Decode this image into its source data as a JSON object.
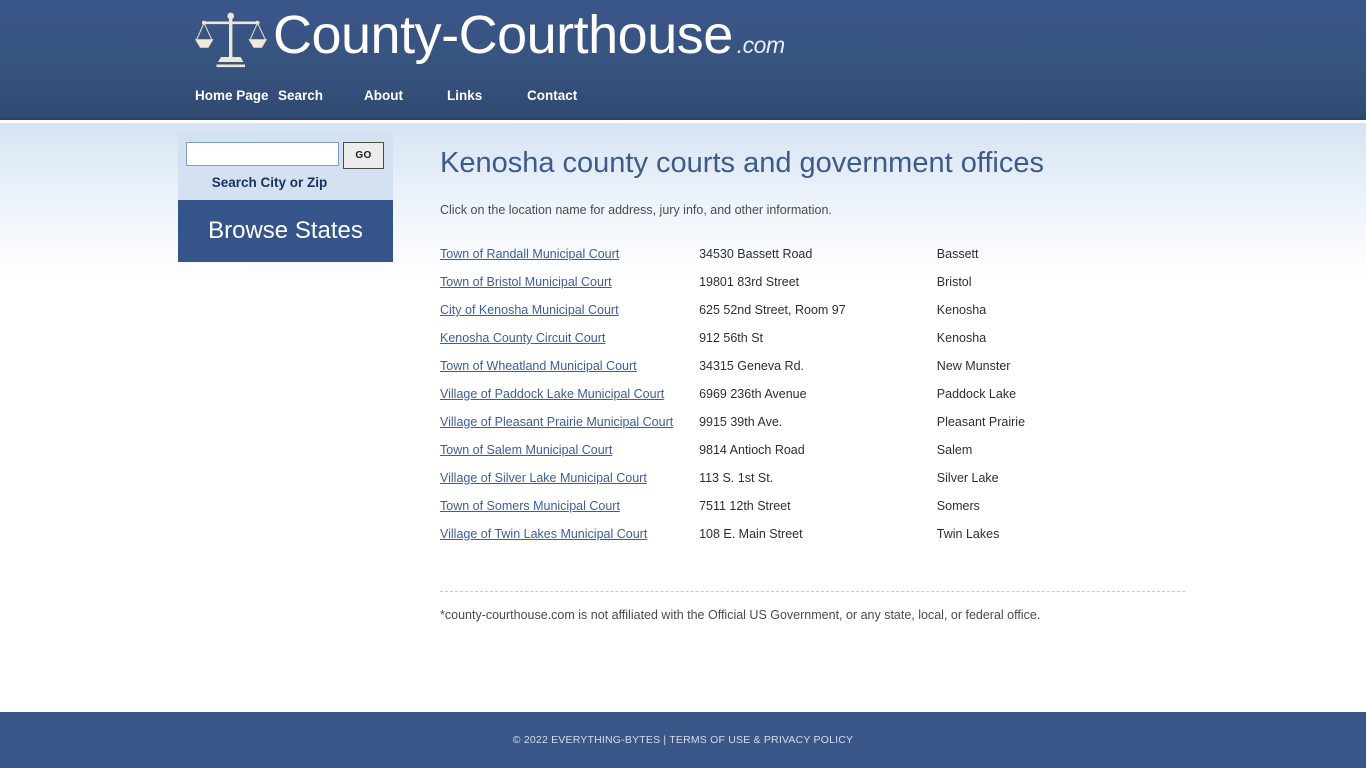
{
  "header": {
    "brand_name": "County-Courthouse",
    "brand_tld": ".com",
    "logo_icon": "scales-of-justice-icon",
    "nav": [
      {
        "label": "Home Page"
      },
      {
        "label": "Search"
      },
      {
        "label": "About"
      },
      {
        "label": "Links"
      },
      {
        "label": "Contact"
      }
    ]
  },
  "sidebar": {
    "search": {
      "value": "",
      "placeholder": "",
      "go_label": "GO",
      "caption": "Search City or Zip"
    },
    "browse_states_label": "Browse States"
  },
  "main": {
    "title": "Kenosha county courts and government offices",
    "intro": "Click on the location name for address, jury info, and other information.",
    "rows": [
      {
        "name": "Town of Randall Municipal Court",
        "address": "34530 Bassett Road",
        "city": "Bassett"
      },
      {
        "name": "Town of Bristol Municipal Court",
        "address": "19801 83rd Street",
        "city": "Bristol"
      },
      {
        "name": "City of Kenosha Municipal Court",
        "address": "625 52nd Street, Room 97",
        "city": "Kenosha"
      },
      {
        "name": "Kenosha County Circuit Court",
        "address": "912 56th St",
        "city": "Kenosha"
      },
      {
        "name": "Town of Wheatland Municipal Court",
        "address": "34315 Geneva Rd.",
        "city": "New Munster"
      },
      {
        "name": "Village of Paddock Lake Municipal Court",
        "address": "6969 236th Avenue",
        "city": "Paddock Lake"
      },
      {
        "name": "Village of Pleasant Prairie Municipal Court",
        "address": "9915 39th Ave.",
        "city": "Pleasant Prairie"
      },
      {
        "name": "Town of Salem Municipal Court",
        "address": "9814 Antioch Road",
        "city": "Salem"
      },
      {
        "name": "Village of Silver Lake Municipal Court",
        "address": "113 S. 1st St.",
        "city": "Silver Lake"
      },
      {
        "name": "Town of Somers Municipal Court",
        "address": "7511 12th Street",
        "city": "Somers"
      },
      {
        "name": "Village of Twin Lakes Municipal Court",
        "address": "108 E. Main Street",
        "city": "Twin Lakes"
      }
    ],
    "disclaimer": "*county-courthouse.com is not affiliated with the Official US Government, or any state, local, or federal office."
  },
  "footer": {
    "copyright": "© 2022 EVERYTHING-BYTES | ",
    "terms_label": "TERMS OF USE & PRIVACY POLICY"
  },
  "colors": {
    "header_blue": "#3b5689",
    "accent_blue": "#35548a",
    "link_blue": "#3a5f9e",
    "title_blue": "#3d5a8a",
    "search_panel": "#d3e1f1"
  }
}
